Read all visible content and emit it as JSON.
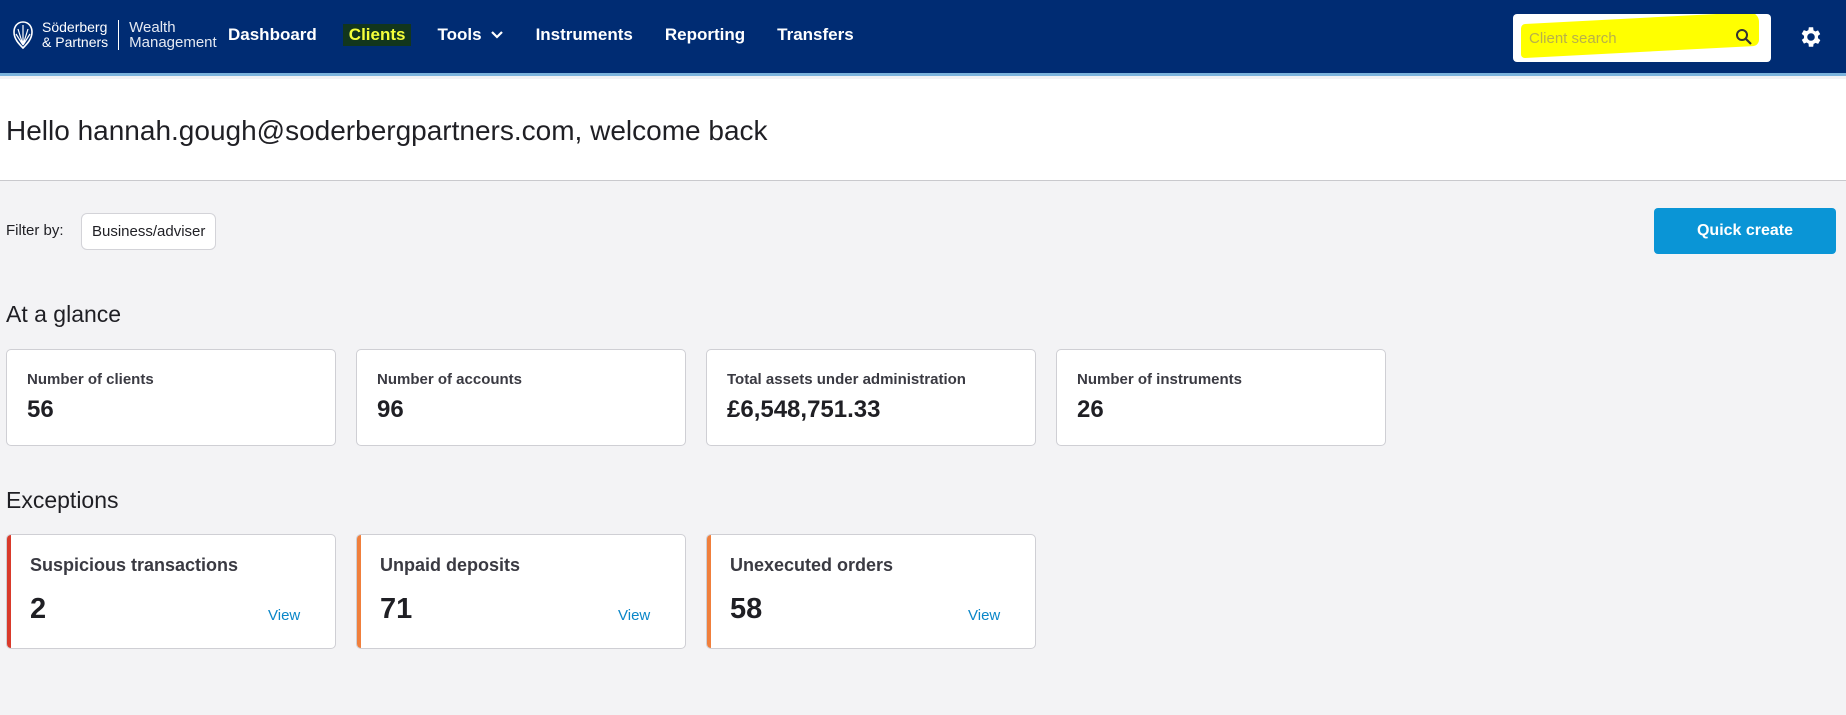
{
  "brand": {
    "name_line1": "Söderberg",
    "name_line2": "& Partners",
    "sub_line1": "Wealth",
    "sub_line2": "Management",
    "logo_icon": "shell-crest-icon"
  },
  "nav": {
    "items": [
      {
        "label": "Dashboard"
      },
      {
        "label": "Clients",
        "active": true
      },
      {
        "label": "Tools",
        "icon": "chevron-down-icon"
      },
      {
        "label": "Instruments"
      },
      {
        "label": "Reporting"
      },
      {
        "label": "Transfers"
      }
    ]
  },
  "search": {
    "placeholder": "Client search",
    "icon": "search-icon"
  },
  "settings": {
    "icon": "gear-icon"
  },
  "welcome": {
    "message": "Hello hannah.gough@soderbergpartners.com, welcome back"
  },
  "filter": {
    "label": "Filter by:",
    "button_label": "Business/adviser"
  },
  "quick_create": {
    "label": "Quick create"
  },
  "glance": {
    "title": "At a glance",
    "cards": [
      {
        "label": "Number of clients",
        "value": "56"
      },
      {
        "label": "Number of accounts",
        "value": "96"
      },
      {
        "label": "Total assets under administration",
        "value": "£6,548,751.33"
      },
      {
        "label": "Number of instruments",
        "value": "26"
      }
    ]
  },
  "exceptions": {
    "title": "Exceptions",
    "cards": [
      {
        "label": "Suspicious transactions",
        "value": "2",
        "link": "View",
        "accent": "#d93a2b"
      },
      {
        "label": "Unpaid deposits",
        "value": "71",
        "link": "View",
        "accent": "#f07f3c"
      },
      {
        "label": "Unexecuted orders",
        "value": "58",
        "link": "View",
        "accent": "#f07f3c"
      }
    ]
  },
  "colors": {
    "topbar": "#002c73",
    "primary_button": "#0a95d6",
    "link": "#0a86c8",
    "active_nav": "#f5ff3a",
    "search_highlight": "#ffff00"
  }
}
